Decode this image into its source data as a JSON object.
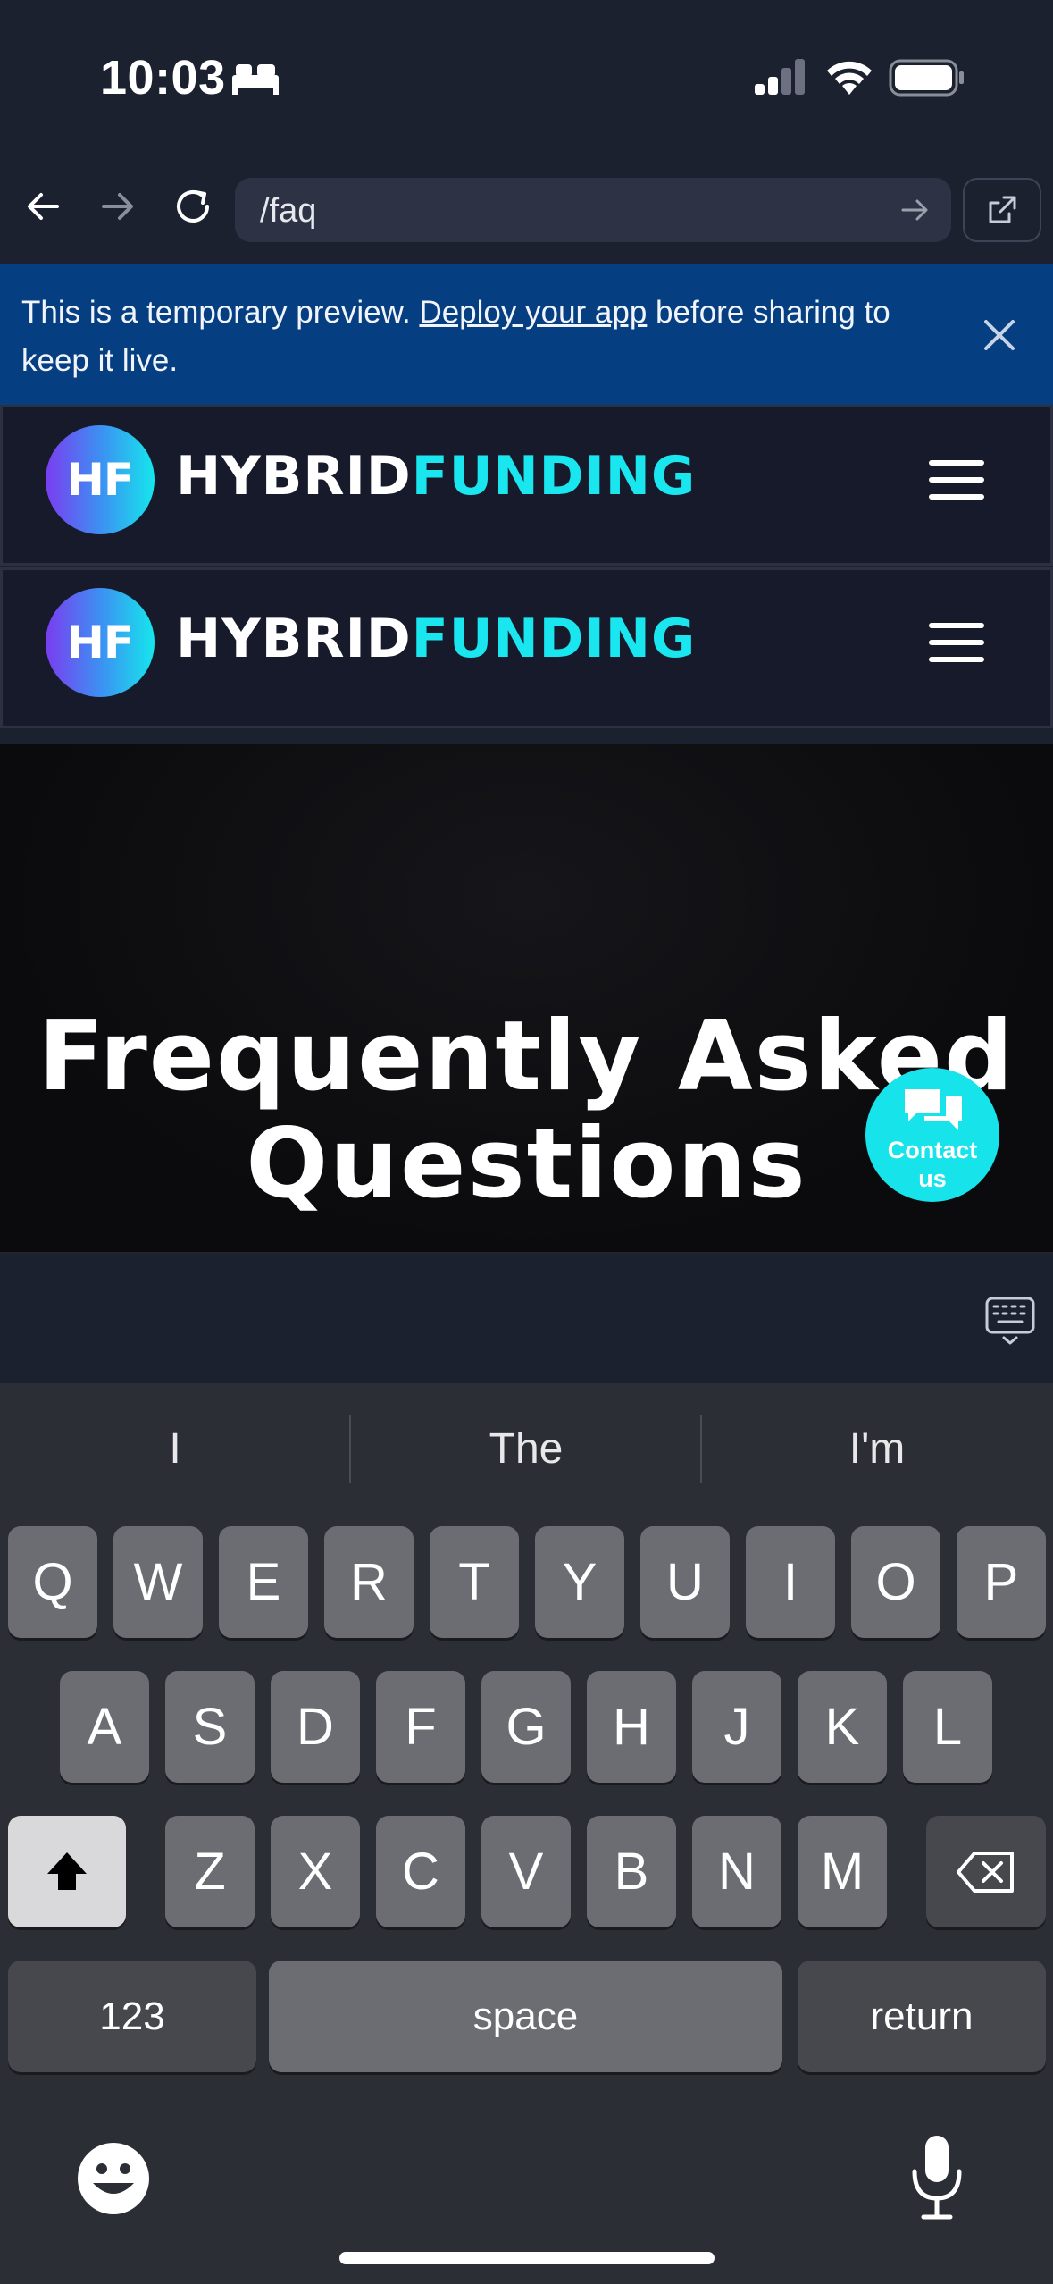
{
  "status_bar": {
    "time": "10:03"
  },
  "browser": {
    "url": "/faq"
  },
  "banner": {
    "text_before": "This is a temporary preview. ",
    "link": "Deploy your app",
    "text_after": " before sharing to keep it live."
  },
  "site": {
    "logo_badge": "HF",
    "brand_part1": "HYBRID",
    "brand_part2": "FUNDING"
  },
  "hero": {
    "title_line1": "Frequently Asked",
    "title_line2": "Questions"
  },
  "contact_fab": {
    "line1": "Contact",
    "line2": "us"
  },
  "keyboard": {
    "suggestions": [
      "I",
      "The",
      "I'm"
    ],
    "row1": [
      "Q",
      "W",
      "E",
      "R",
      "T",
      "Y",
      "U",
      "I",
      "O",
      "P"
    ],
    "row2": [
      "A",
      "S",
      "D",
      "F",
      "G",
      "H",
      "J",
      "K",
      "L"
    ],
    "row3": [
      "Z",
      "X",
      "C",
      "V",
      "B",
      "N",
      "M"
    ],
    "numbers_label": "123",
    "space_label": "space",
    "return_label": "return"
  },
  "colors": {
    "accent_cyan": "#19e6ef",
    "banner_blue": "#063e82",
    "page_bg": "#1c2130"
  }
}
